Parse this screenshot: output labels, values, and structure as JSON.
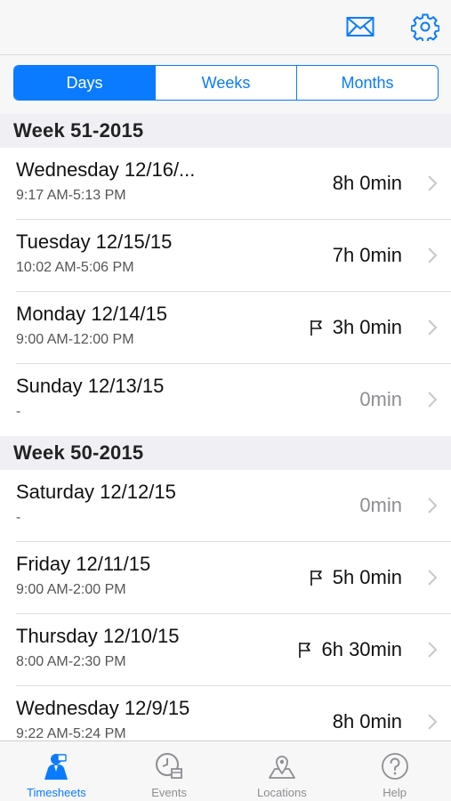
{
  "colors": {
    "accent": "#0a7bff",
    "inactive": "#8e8e93",
    "section_bg": "#efeff4"
  },
  "navbar": {
    "icons": [
      "mail-icon",
      "gear-icon"
    ]
  },
  "segmented": {
    "days": "Days",
    "weeks": "Weeks",
    "months": "Months",
    "selected": "Days"
  },
  "sections": [
    {
      "title": "Week 51-2015",
      "rows": [
        {
          "title": "Wednesday 12/16/...",
          "time": "9:17 AM-5:13 PM",
          "duration": "8h 0min",
          "flag": false
        },
        {
          "title": "Tuesday 12/15/15",
          "time": "10:02 AM-5:06 PM",
          "duration": "7h 0min",
          "flag": false
        },
        {
          "title": "Monday 12/14/15",
          "time": "9:00 AM-12:00 PM",
          "duration": "3h 0min",
          "flag": true
        },
        {
          "title": "Sunday 12/13/15",
          "time": "-",
          "duration": "0min",
          "flag": false
        }
      ]
    },
    {
      "title": "Week 50-2015",
      "rows": [
        {
          "title": "Saturday 12/12/15",
          "time": "-",
          "duration": "0min",
          "flag": false
        },
        {
          "title": "Friday 12/11/15",
          "time": "9:00 AM-2:00 PM",
          "duration": "5h 0min",
          "flag": true
        },
        {
          "title": "Thursday 12/10/15",
          "time": "8:00 AM-2:30 PM",
          "duration": "6h 30min",
          "flag": true
        },
        {
          "title": "Wednesday 12/9/15",
          "time": "9:22 AM-5:24 PM",
          "duration": "8h 0min",
          "flag": false
        }
      ]
    }
  ],
  "tabbar": {
    "timesheets": "Timesheets",
    "events": "Events",
    "locations": "Locations",
    "help": "Help",
    "selected": "Timesheets"
  }
}
